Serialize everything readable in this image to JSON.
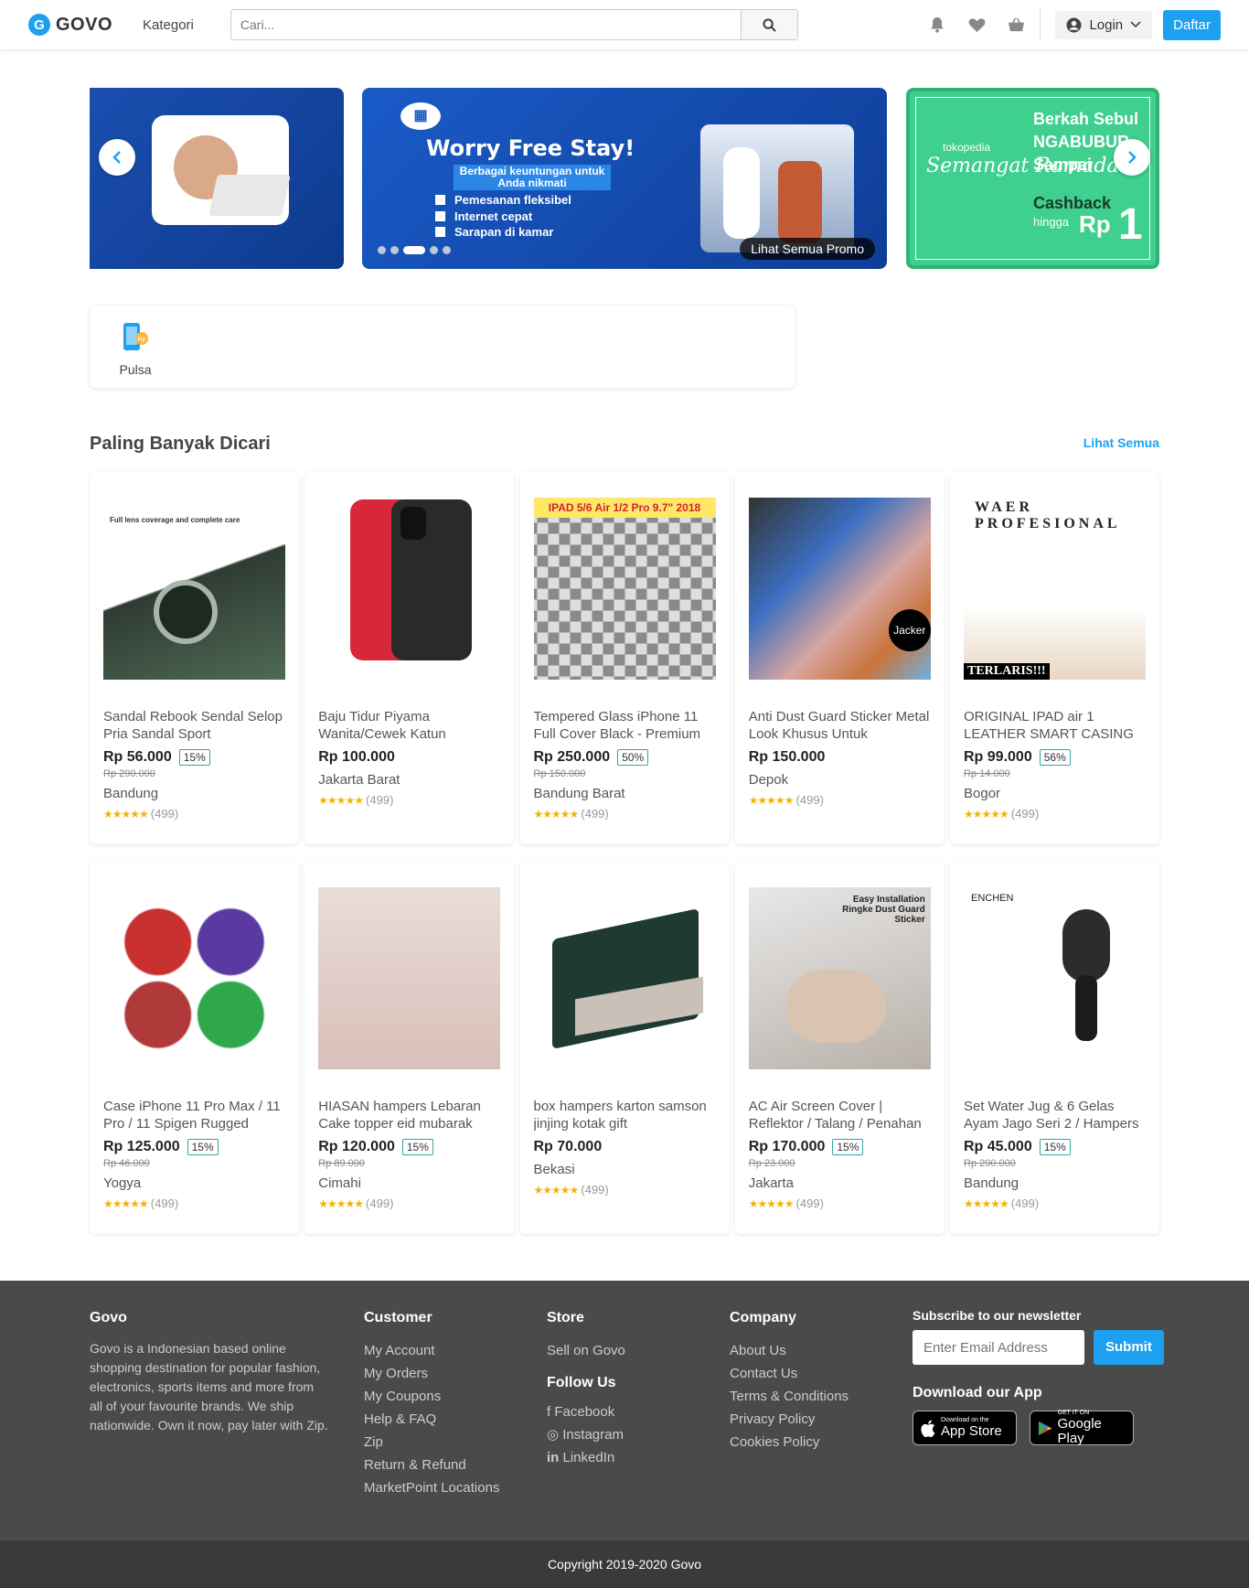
{
  "header": {
    "logo_text": "GOVO",
    "logo_letter": "G",
    "kategori": "Kategori",
    "search_placeholder": "Cari...",
    "login": "Login",
    "register": "Daftar"
  },
  "banners": {
    "b2_title": "Worry Free Stay!",
    "b2_sub": "Berbagai keuntungan untuk Anda nikmati",
    "b2_list": [
      "Pemesanan fleksibel",
      "Internet cepat",
      "Sarapan di kamar"
    ],
    "see_all": "Lihat Semua Promo",
    "b3_brand": "tokopedia",
    "b3_script": "Semangat Ramadan",
    "b3_r1": "Berkah Sebul",
    "b3_r2": "NGABUBUR",
    "b3_r3": "Sampai",
    "b3_cashback": "Cashback",
    "b3_hingga": "hingga",
    "b3_rp": "Rp",
    "b3_big": "1",
    "active_dot": 3,
    "dot_count": 5
  },
  "categories": [
    {
      "label": "Pulsa"
    }
  ],
  "section": {
    "title": "Paling Banyak Dicari",
    "link": "Lihat Semua"
  },
  "products": [
    {
      "name": "Sandal Rebook Sendal Selop Pria Sandal Sport",
      "price": "Rp 56.000",
      "discount": "15%",
      "old_price": "Rp 290.000",
      "location": "Bandung",
      "rating_count": "(499)"
    },
    {
      "name": "Baju Tidur Piyama Wanita/Cewek Katun",
      "price": "Rp 100.000",
      "discount": "",
      "old_price": "",
      "location": "Jakarta Barat",
      "rating_count": "(499)"
    },
    {
      "name": "Tempered Glass iPhone 11 Full Cover Black - Premium",
      "price": "Rp 250.000",
      "discount": "50%",
      "old_price": "Rp 150.000",
      "location": "Bandung Barat",
      "rating_count": "(499)"
    },
    {
      "name": "Anti Dust Guard Sticker Metal Look Khusus Untuk",
      "price": "Rp 150.000",
      "discount": "",
      "old_price": "",
      "location": "Depok",
      "rating_count": "(499)"
    },
    {
      "name": "ORIGINAL IPAD air 1 LEATHER SMART CASING",
      "price": "Rp 99.000",
      "discount": "56%",
      "old_price": "Rp 14.000",
      "location": "Bogor",
      "rating_count": "(499)"
    },
    {
      "name": "Case iPhone 11 Pro Max / 11 Pro / 11 Spigen Rugged",
      "price": "Rp 125.000",
      "discount": "15%",
      "old_price": "Rp 46.000",
      "location": "Yogya",
      "rating_count": "(499)"
    },
    {
      "name": "HIASAN hampers Lebaran Cake topper eid mubarak",
      "price": "Rp 120.000",
      "discount": "15%",
      "old_price": "Rp 89.000",
      "location": "Cimahi",
      "rating_count": "(499)"
    },
    {
      "name": "box hampers karton samson jinjing kotak gift",
      "price": "Rp 70.000",
      "discount": "",
      "old_price": "",
      "location": "Bekasi",
      "rating_count": "(499)"
    },
    {
      "name": "AC Air Screen Cover | Reflektor / Talang / Penahan",
      "price": "Rp 170.000",
      "discount": "15%",
      "old_price": "Rp 23.000",
      "location": "Jakarta",
      "rating_count": "(499)"
    },
    {
      "name": "Set Water Jug & 6 Gelas Ayam Jago Seri 2 / Hampers",
      "price": "Rp 45.000",
      "discount": "15%",
      "old_price": "Rp 290.000",
      "location": "Bandung",
      "rating_count": "(499)"
    }
  ],
  "product_images": [
    {
      "caption": "Full lens coverage and complete care"
    },
    {
      "caption": ""
    },
    {
      "caption": "IPAD 5/6 Air 1/2 Pro 9.7\" 2018"
    },
    {
      "caption": "Jacker"
    },
    {
      "caption": "WAER PROFESIONAL",
      "badge": "TERLARIS!!!"
    },
    {
      "caption": ""
    },
    {
      "caption": ""
    },
    {
      "caption": ""
    },
    {
      "caption": "Easy Installation Ringke Dust Guard Sticker"
    },
    {
      "caption": "ENCHEN"
    }
  ],
  "footer": {
    "about_title": "Govo",
    "about_text": "Govo is a Indonesian based online shopping destination for popular fashion, electronics, sports items and more from all of your favourite brands. We ship nationwide. Own it now, pay later with Zip.",
    "customer_title": "Customer",
    "customer_links": [
      "My Account",
      "My Orders",
      "My Coupons",
      "Help & FAQ",
      "Zip",
      "Return & Refund",
      "MarketPoint Locations"
    ],
    "store_title": "Store",
    "store_links": [
      "Sell on Govo"
    ],
    "follow_title": "Follow Us",
    "follow_links": [
      "Facebook",
      "Instagram",
      "LinkedIn"
    ],
    "company_title": "Company",
    "company_links": [
      "About Us",
      "Contact Us",
      "Terms & Conditions",
      "Privacy Policy",
      "Cookies Policy"
    ],
    "newsletter_title": "Subscribe to our newsletter",
    "email_placeholder": "Enter Email Address",
    "submit": "Submit",
    "app_title": "Download our App",
    "appstore_small": "Download on the",
    "appstore_big": "App Store",
    "gplay_small": "GET IT ON",
    "gplay_big": "Google Play"
  },
  "copyright": "Copyright 2019-2020 Govo",
  "colors": {
    "accent": "#1ea0f0",
    "footer": "#4a4a4a",
    "star": "#f5b400"
  }
}
